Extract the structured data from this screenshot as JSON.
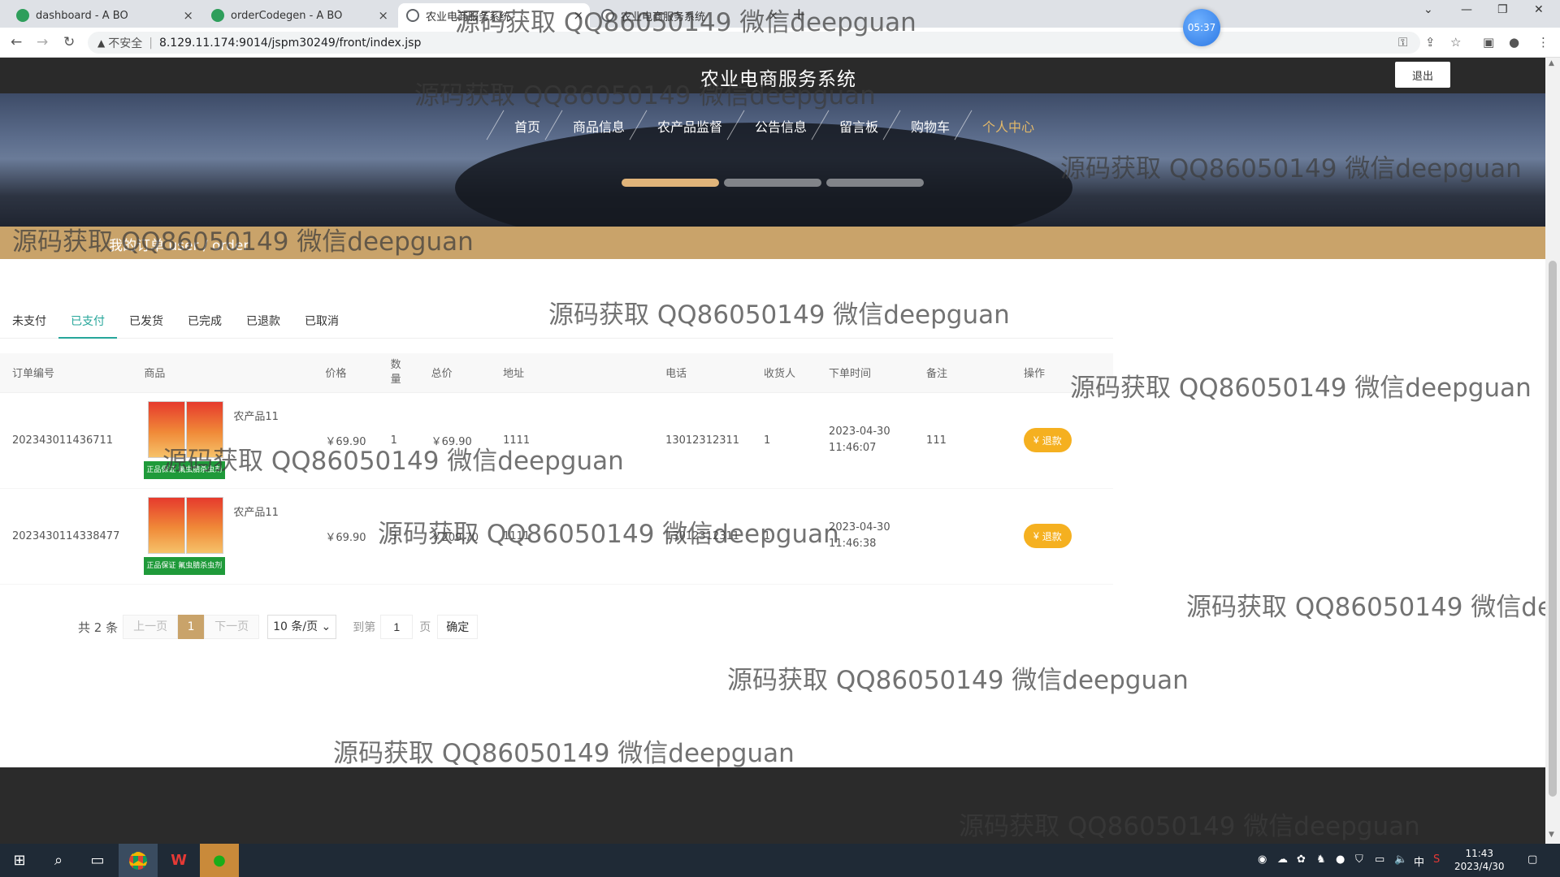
{
  "browser": {
    "tabs": [
      {
        "title": "dashboard - A BO",
        "color": "#2e9e5b"
      },
      {
        "title": "orderCodegen - A BO",
        "color": "#2e9e5b"
      },
      {
        "title": "农业电商服务系统",
        "color": "#5f6368"
      }
    ],
    "timer": "05:37",
    "insecure_label": "不安全",
    "url": "8.129.11.174:9014/jspm30249/front/index.jsp"
  },
  "site": {
    "title": "农业电商服务系统",
    "logout": "退出",
    "nav": [
      "首页",
      "商品信息",
      "农产品监督",
      "公告信息",
      "留言板",
      "购物车",
      "个人中心"
    ],
    "active_nav": "个人中心",
    "breadcrumb": "我的订单 user / order"
  },
  "orders": {
    "tabs": [
      "未支付",
      "已支付",
      "已发货",
      "已完成",
      "已退款",
      "已取消"
    ],
    "active_tab": "已支付",
    "columns": [
      "订单编号",
      "商品",
      "价格",
      "数量",
      "总价",
      "地址",
      "电话",
      "收货人",
      "下单时间",
      "备注",
      "操作"
    ],
    "rows": [
      {
        "id": "202343011436711",
        "goods": "农产品11",
        "price": "￥69.90",
        "qty": "1",
        "total": "￥69.90",
        "address": "1111",
        "phone": "13012312311",
        "receiver": "1",
        "time": "2023-04-30 11:46:07",
        "note": "111",
        "action": "退款"
      },
      {
        "id": "2023430114338477",
        "goods": "农产品11",
        "price": "￥69.90",
        "qty": "3",
        "total": "￥209.70",
        "address": "1111",
        "phone": "13012312311",
        "receiver": "1",
        "time": "2023-04-30 11:46:38",
        "note": "",
        "action": "退款"
      }
    ],
    "package_band_text": "正品保证 氟虫腈杀虫剂"
  },
  "pager": {
    "total": "共 2 条",
    "prev": "上一页",
    "page": "1",
    "next": "下一页",
    "size": "10 条/页",
    "goto": "到第",
    "goto_value": "1",
    "page_unit": "页",
    "confirm": "确定"
  },
  "watermark": "源码获取 QQ86050149 微信deepguan",
  "taskbar": {
    "time": "11:43",
    "date": "2023/4/30",
    "ime": "中"
  },
  "colors": {
    "accent": "#26a69a",
    "gold": "#c9a36a",
    "refund": "#f5b020"
  }
}
